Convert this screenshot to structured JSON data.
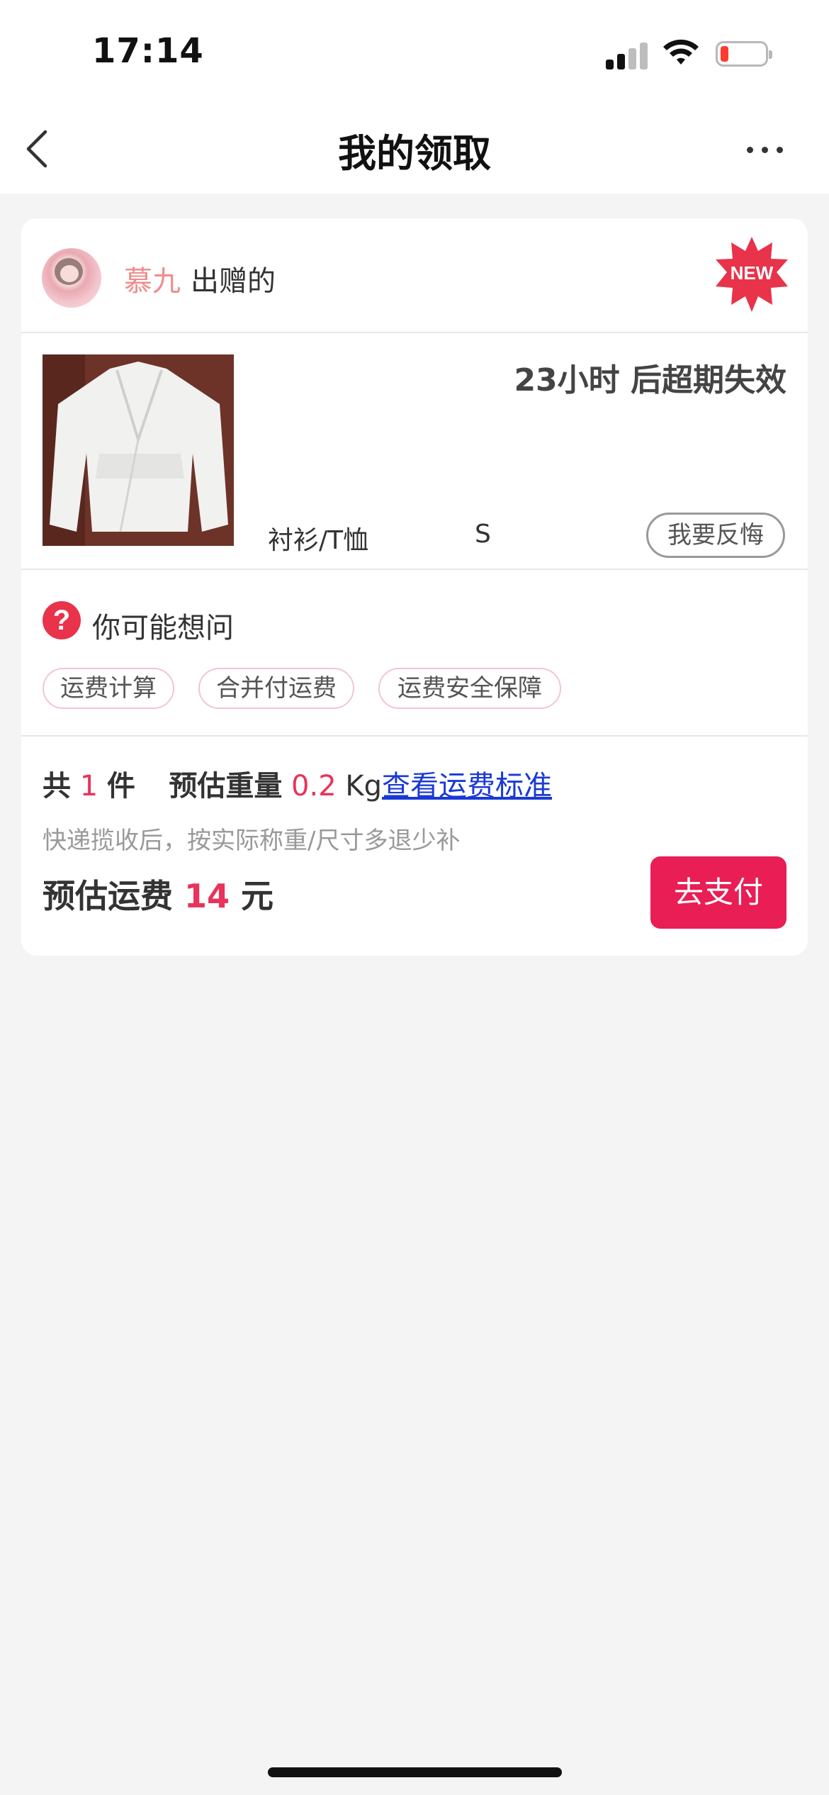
{
  "status_bar": {
    "time": "17:14",
    "icons": [
      "cellular-signal-icon",
      "wifi-icon",
      "battery-low-icon"
    ],
    "battery_color": "#ff3b30"
  },
  "nav": {
    "title": "我的领取",
    "back_icon": "chevron-left-icon",
    "more_icon": "more-dots-icon"
  },
  "giver": {
    "name": "慕九",
    "suffix": "出赠的",
    "badge": "NEW",
    "badge_color": "#e8334a"
  },
  "product": {
    "countdown": "23小时 后超期失效",
    "category": "衬衫/T恤",
    "size": "S",
    "regret_label": "我要反悔"
  },
  "faq": {
    "title": "你可能想问",
    "icon": "question-circle-icon",
    "tags": [
      "运费计算",
      "合并付运费",
      "运费安全保障"
    ]
  },
  "summary": {
    "total_prefix": "共",
    "count": "1",
    "count_unit": "件",
    "weight_label": "预估重量",
    "weight_value": "0.2",
    "weight_unit": "Kg",
    "fee_standard_link": "查看运费标准",
    "note": "快递揽收后，按实际称重/尺寸多退少补",
    "fee_label": "预估运费",
    "fee_value": "14",
    "fee_unit": "元",
    "pay_label": "去支付",
    "accent_color": "#e8335a"
  }
}
